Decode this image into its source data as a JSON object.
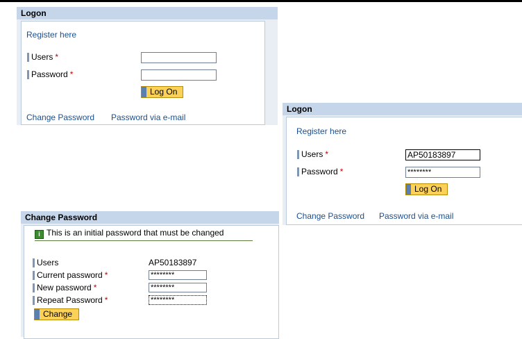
{
  "logon1": {
    "title": "Logon",
    "register_link": "Register here",
    "users_label": "Users",
    "password_label": "Password",
    "required_mark": "*",
    "users_value": "",
    "password_value": "",
    "logon_button": "Log On",
    "change_password_link": "Change Password",
    "password_email_link": "Password via e-mail"
  },
  "logon2": {
    "title": "Logon",
    "register_link": "Register here",
    "users_label": "Users",
    "password_label": "Password",
    "required_mark": "*",
    "users_value": "AP50183897",
    "password_value": "********",
    "logon_button": "Log On",
    "change_password_link": "Change Password",
    "password_email_link": "Password via e-mail"
  },
  "change_password": {
    "title": "Change Password",
    "info_icon": "info-icon",
    "info_message": "This is an initial password that must be changed",
    "users_label": "Users",
    "users_value": "AP50183897",
    "current_password_label": "Current password",
    "current_password_value": "********",
    "new_password_label": "New password",
    "new_password_value": "********",
    "repeat_password_label": "Repeat Password",
    "repeat_password_value": "********",
    "required_mark": "*",
    "change_button": "Change"
  },
  "colors": {
    "title_bar": "#c6d6ea",
    "panel_bg": "#e9eef5",
    "link": "#1a4f8f",
    "button": "#fbd15a",
    "required": "#c00000"
  }
}
